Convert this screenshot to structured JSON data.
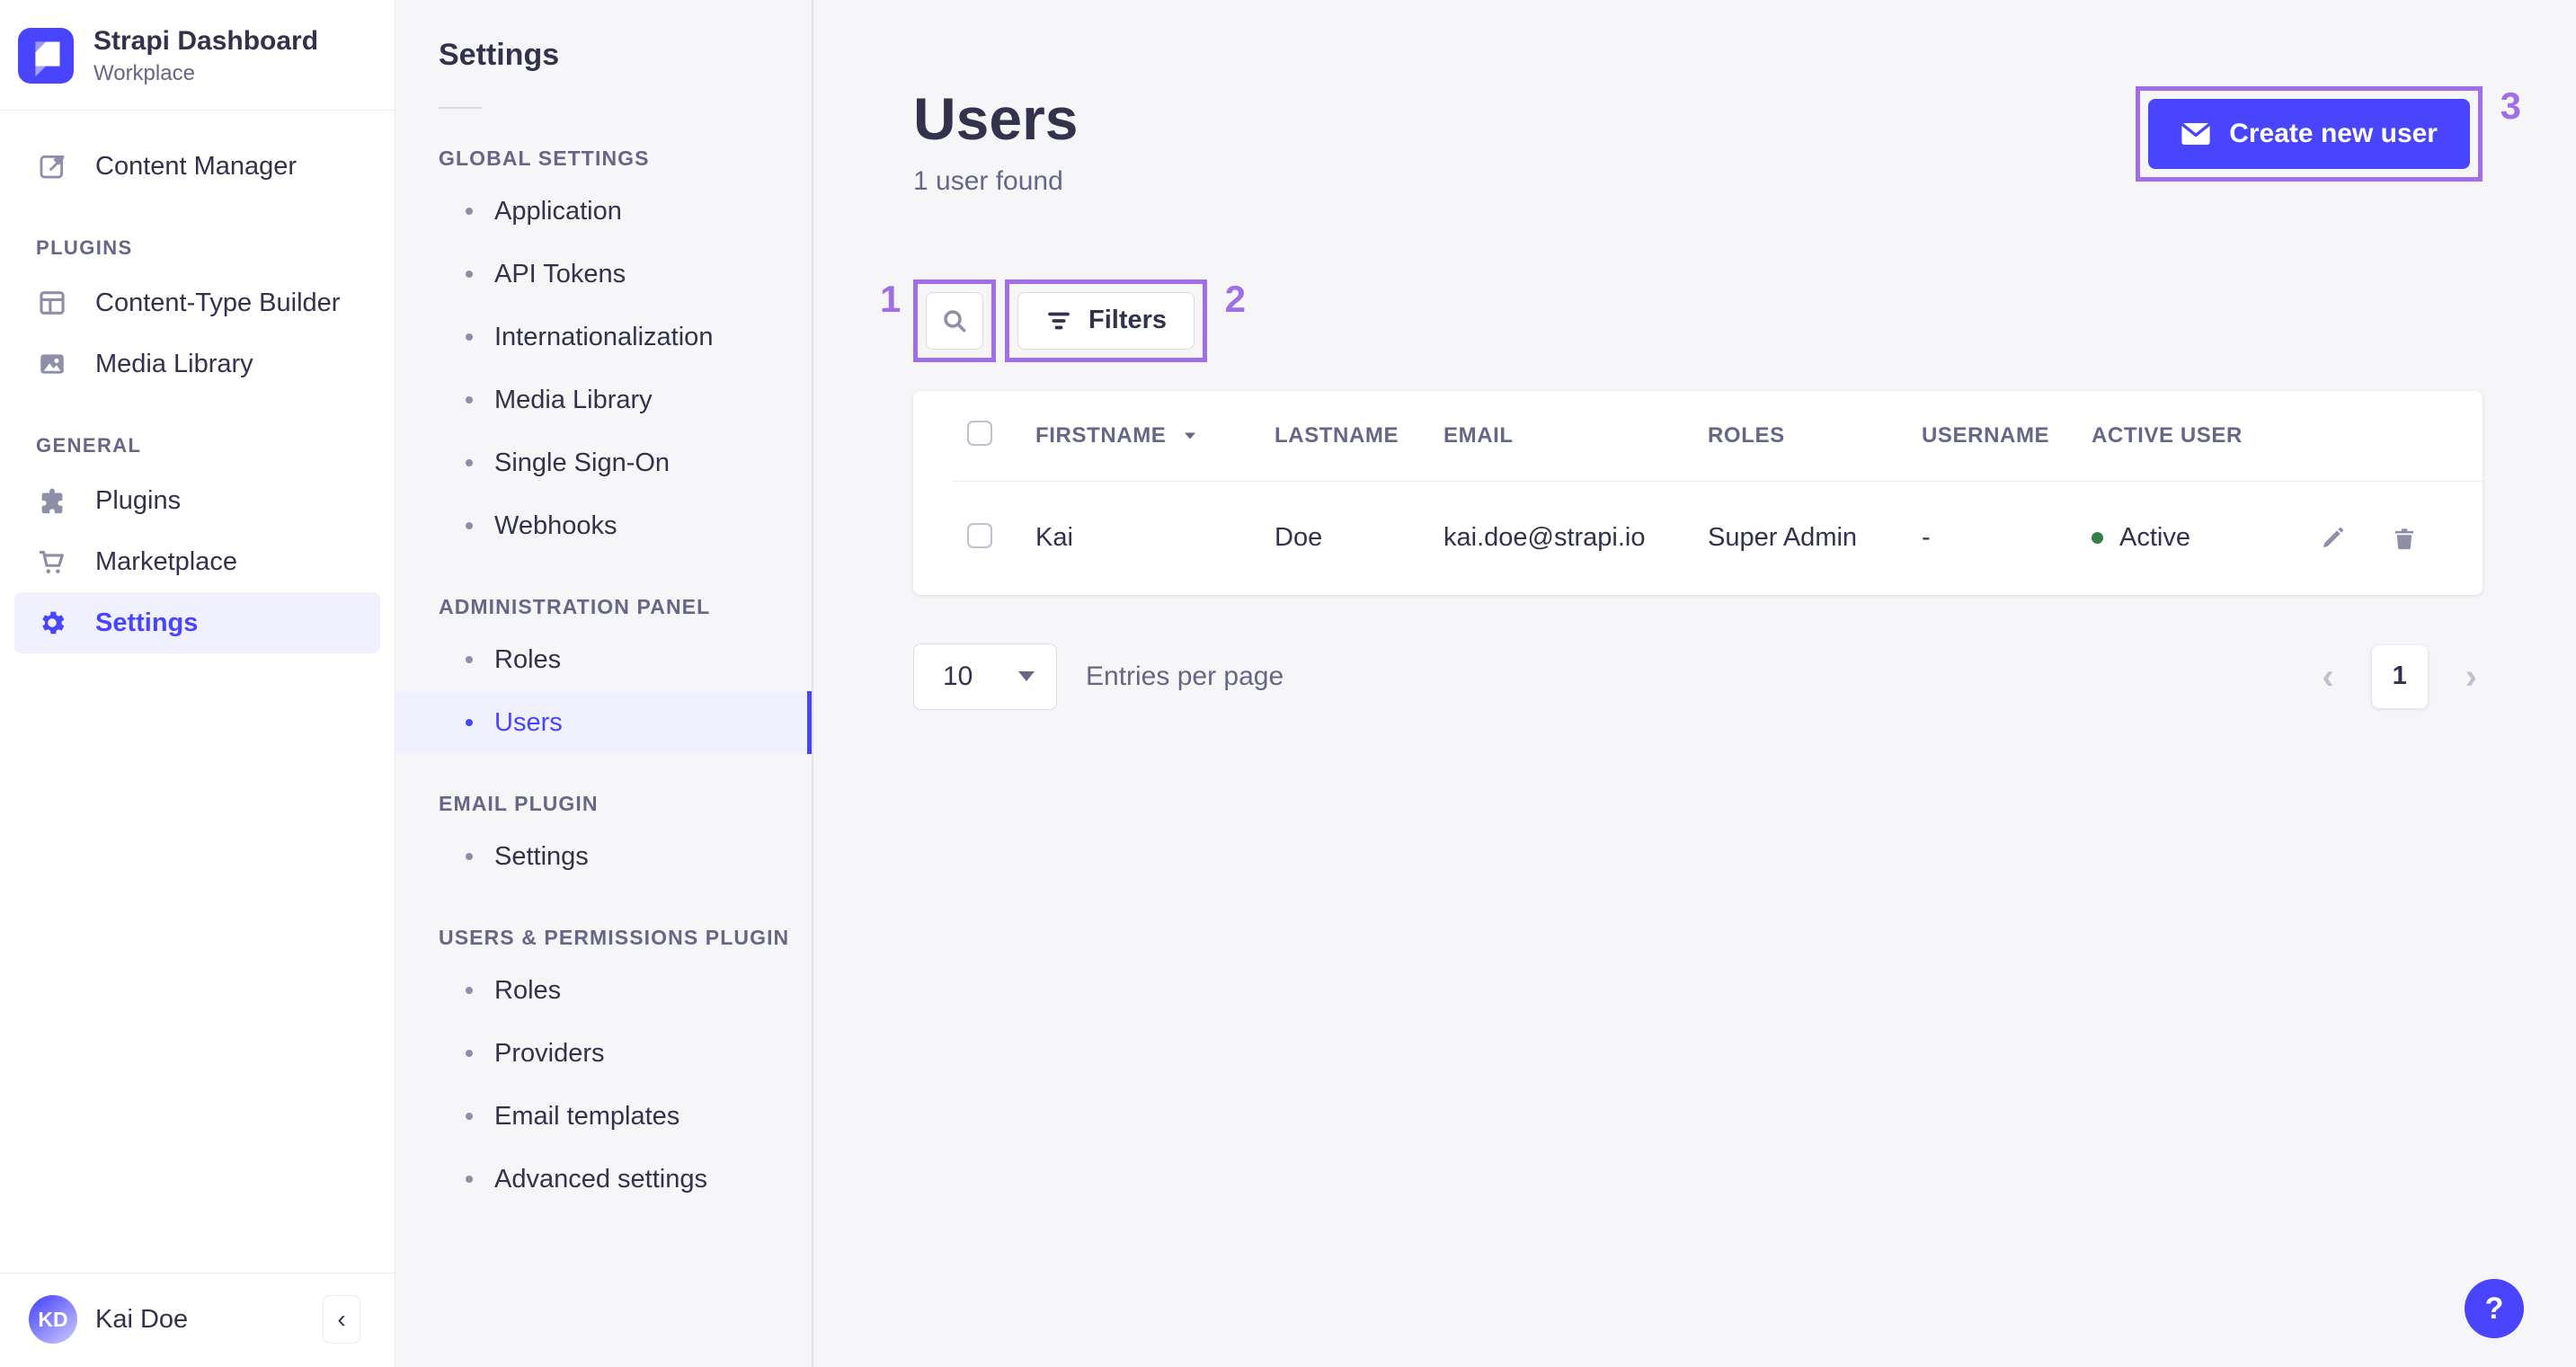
{
  "brand": {
    "title": "Strapi Dashboard",
    "subtitle": "Workplace"
  },
  "nav": {
    "items": {
      "content_manager": "Content Manager",
      "content_type_builder": "Content-Type Builder",
      "media_library": "Media Library",
      "plugins": "Plugins",
      "marketplace": "Marketplace",
      "settings": "Settings"
    },
    "section_labels": {
      "plugins": "PLUGINS",
      "general": "GENERAL"
    },
    "user": {
      "initials": "KD",
      "name": "Kai Doe"
    },
    "collapse_glyph": "‹"
  },
  "settings_nav": {
    "heading": "Settings",
    "sections": [
      {
        "label": "GLOBAL SETTINGS",
        "items": [
          "Application",
          "API Tokens",
          "Internationalization",
          "Media Library",
          "Single Sign-On",
          "Webhooks"
        ]
      },
      {
        "label": "ADMINISTRATION PANEL",
        "items": [
          "Roles",
          "Users"
        ]
      },
      {
        "label": "EMAIL PLUGIN",
        "items": [
          "Settings"
        ]
      },
      {
        "label": "USERS & PERMISSIONS PLUGIN",
        "items": [
          "Roles",
          "Providers",
          "Email templates",
          "Advanced settings"
        ]
      }
    ]
  },
  "main": {
    "title": "Users",
    "subtitle": "1 user found",
    "create_button_label": "Create new user",
    "filters_button_label": "Filters",
    "table": {
      "headers": {
        "firstname": "FIRSTNAME",
        "lastname": "LASTNAME",
        "email": "EMAIL",
        "roles": "ROLES",
        "username": "USERNAME",
        "active_user": "ACTIVE USER"
      },
      "rows": [
        {
          "firstname": "Kai",
          "lastname": "Doe",
          "email": "kai.doe@strapi.io",
          "roles": "Super Admin",
          "username": "-",
          "active_status": "Active"
        }
      ]
    },
    "pagination": {
      "page_size": "10",
      "entries_label": "Entries per page",
      "current_page": "1"
    }
  },
  "annotations": {
    "one": "1",
    "two": "2",
    "three": "3",
    "color": "#a06ee8"
  },
  "help_button_label": "?",
  "colors": {
    "primary": "#4945ff",
    "primary_light": "#f0f0ff",
    "text_dark": "#32324d",
    "text_muted": "#666687",
    "border": "#eaeaef",
    "app_bg": "#f6f6f9",
    "success": "#328048",
    "annotation": "#a06ee8"
  }
}
